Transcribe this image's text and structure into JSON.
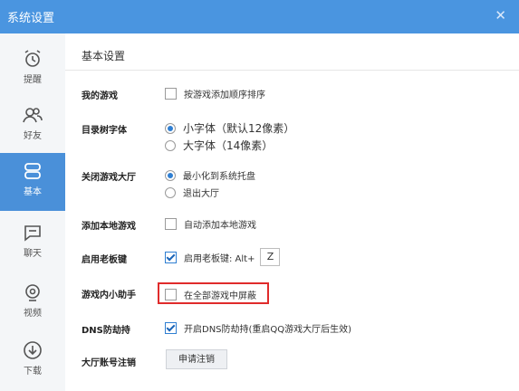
{
  "window": {
    "title": "系统设置",
    "close_glyph": "✕"
  },
  "sidebar": {
    "items": [
      {
        "label": "提醒",
        "icon": "alarm-clock-icon"
      },
      {
        "label": "好友",
        "icon": "friends-icon"
      },
      {
        "label": "基本",
        "icon": "settings-icon",
        "active": true
      },
      {
        "label": "聊天",
        "icon": "chat-icon"
      },
      {
        "label": "视频",
        "icon": "video-icon"
      },
      {
        "label": "下载",
        "icon": "download-icon"
      }
    ]
  },
  "main": {
    "heading": "基本设置",
    "sections": {
      "my_games": {
        "label": "我的游戏",
        "option": "按游戏添加顺序排序",
        "checked": false
      },
      "tree_font": {
        "label": "目录树字体",
        "options": [
          "小字体（默认12像素）",
          "大字体（14像素）"
        ],
        "selected": 0
      },
      "close_hall": {
        "label": "关闭游戏大厅",
        "options": [
          "最小化到系统托盘",
          "退出大厅"
        ],
        "selected": 0
      },
      "add_local": {
        "label": "添加本地游戏",
        "option": "自动添加本地游戏",
        "checked": false
      },
      "boss_key": {
        "label": "启用老板键",
        "option": "启用老板键: Alt+",
        "key": "Z",
        "checked": true
      },
      "assistant": {
        "label": "游戏内小助手",
        "option": "在全部游戏中屏蔽",
        "checked": false
      },
      "dns": {
        "label": "DNS防劫持",
        "option": "开启DNS防劫持(重启QQ游戏大厅后生效)",
        "checked": true
      },
      "account": {
        "label": "大厅账号注销",
        "button": "申请注销"
      }
    }
  },
  "colors": {
    "titlebar": "#4a95e0",
    "active_nav": "#4a90d9",
    "highlight": "#e02b2b",
    "accent": "#2f7fd2"
  }
}
